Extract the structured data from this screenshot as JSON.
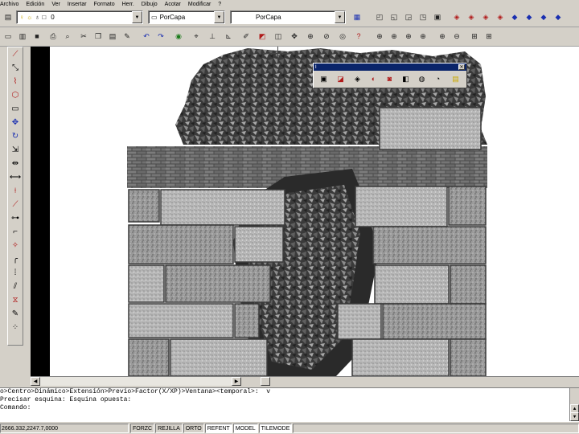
{
  "menubar": {
    "items": [
      "Archivo",
      "Edición",
      "Ver",
      "Insertar",
      "Formato",
      "Herr.",
      "Dibujo",
      "Acotar",
      "Modificar",
      "?"
    ]
  },
  "layer_bar": {
    "layer_name": "0",
    "linetype": "PorCapa",
    "color": "PorCapa"
  },
  "float_toolbar": {
    "title": "i"
  },
  "command": {
    "lines": [
      "o>Centro>Dinámico>Extensión>Previo>Factor(X/XP)>Ventana><temporal>:  v",
      "Precisar esquina: Esquina opuesta:",
      "Comando:"
    ]
  },
  "status": {
    "coordinates": "2666.332,2247.7,0000",
    "buttons": [
      {
        "label": "FORZC",
        "active": false
      },
      {
        "label": "REJILLA",
        "active": false
      },
      {
        "label": "ORTO",
        "active": false
      },
      {
        "label": "REFENT",
        "active": true
      },
      {
        "label": "MODEL",
        "active": true
      },
      {
        "label": "TILEMODE",
        "active": true
      }
    ]
  }
}
